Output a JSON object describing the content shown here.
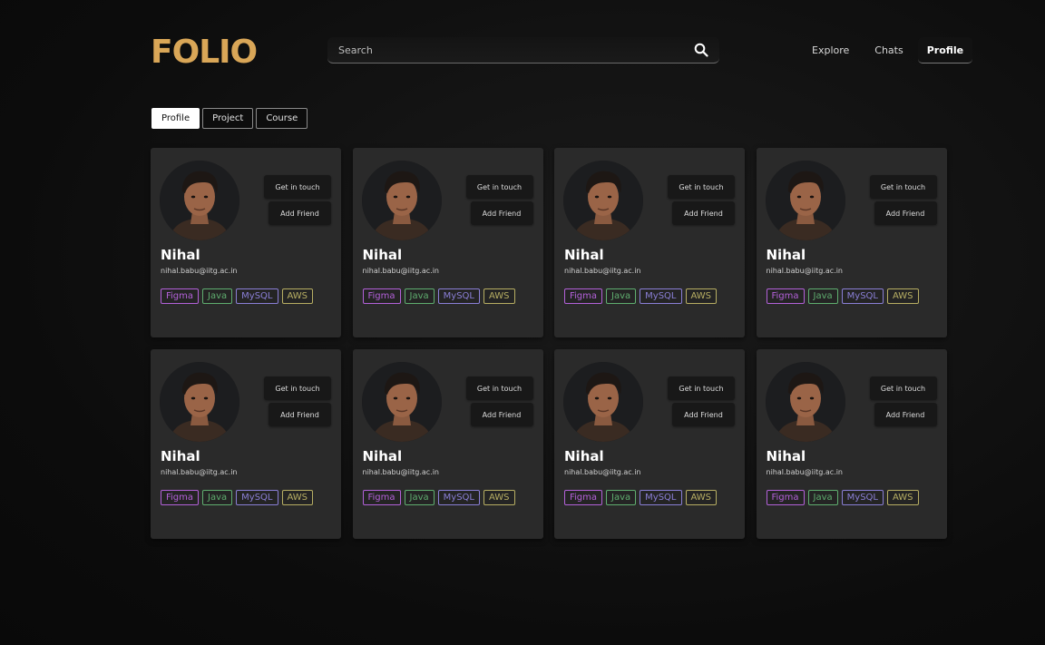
{
  "header": {
    "logo": "FOLIO",
    "search_placeholder": "Search",
    "nav": [
      {
        "label": "Explore"
      },
      {
        "label": "Chats"
      },
      {
        "label": "Profile",
        "active": true
      }
    ]
  },
  "tabs": [
    {
      "label": "Profile",
      "active": true
    },
    {
      "label": "Project"
    },
    {
      "label": "Course"
    }
  ],
  "colors": {
    "accent": "#d9a657",
    "figma": "#b361d9",
    "java": "#5fae6f",
    "mysql": "#8a7fd6",
    "aws": "#b7ae63"
  },
  "cards": [
    {
      "name": "Nihal",
      "email": "nihal.babu@iitg.ac.in",
      "get_in_touch": "Get in touch",
      "add_friend": "Add Friend",
      "skills": [
        "Figma",
        "Java",
        "MySQL",
        "AWS"
      ]
    },
    {
      "name": "Nihal",
      "email": "nihal.babu@iitg.ac.in",
      "get_in_touch": "Get in touch",
      "add_friend": "Add Friend",
      "skills": [
        "Figma",
        "Java",
        "MySQL",
        "AWS"
      ]
    },
    {
      "name": "Nihal",
      "email": "nihal.babu@iitg.ac.in",
      "get_in_touch": "Get in touch",
      "add_friend": "Add Friend",
      "skills": [
        "Figma",
        "Java",
        "MySQL",
        "AWS"
      ]
    },
    {
      "name": "Nihal",
      "email": "nihal.babu@iitg.ac.in",
      "get_in_touch": "Get in touch",
      "add_friend": "Add Friend",
      "skills": [
        "Figma",
        "Java",
        "MySQL",
        "AWS"
      ]
    },
    {
      "name": "Nihal",
      "email": "nihal.babu@iitg.ac.in",
      "get_in_touch": "Get in touch",
      "add_friend": "Add Friend",
      "skills": [
        "Figma",
        "Java",
        "MySQL",
        "AWS"
      ]
    },
    {
      "name": "Nihal",
      "email": "nihal.babu@iitg.ac.in",
      "get_in_touch": "Get in touch",
      "add_friend": "Add Friend",
      "skills": [
        "Figma",
        "Java",
        "MySQL",
        "AWS"
      ]
    },
    {
      "name": "Nihal",
      "email": "nihal.babu@iitg.ac.in",
      "get_in_touch": "Get in touch",
      "add_friend": "Add Friend",
      "skills": [
        "Figma",
        "Java",
        "MySQL",
        "AWS"
      ]
    },
    {
      "name": "Nihal",
      "email": "nihal.babu@iitg.ac.in",
      "get_in_touch": "Get in touch",
      "add_friend": "Add Friend",
      "skills": [
        "Figma",
        "Java",
        "MySQL",
        "AWS"
      ]
    }
  ]
}
